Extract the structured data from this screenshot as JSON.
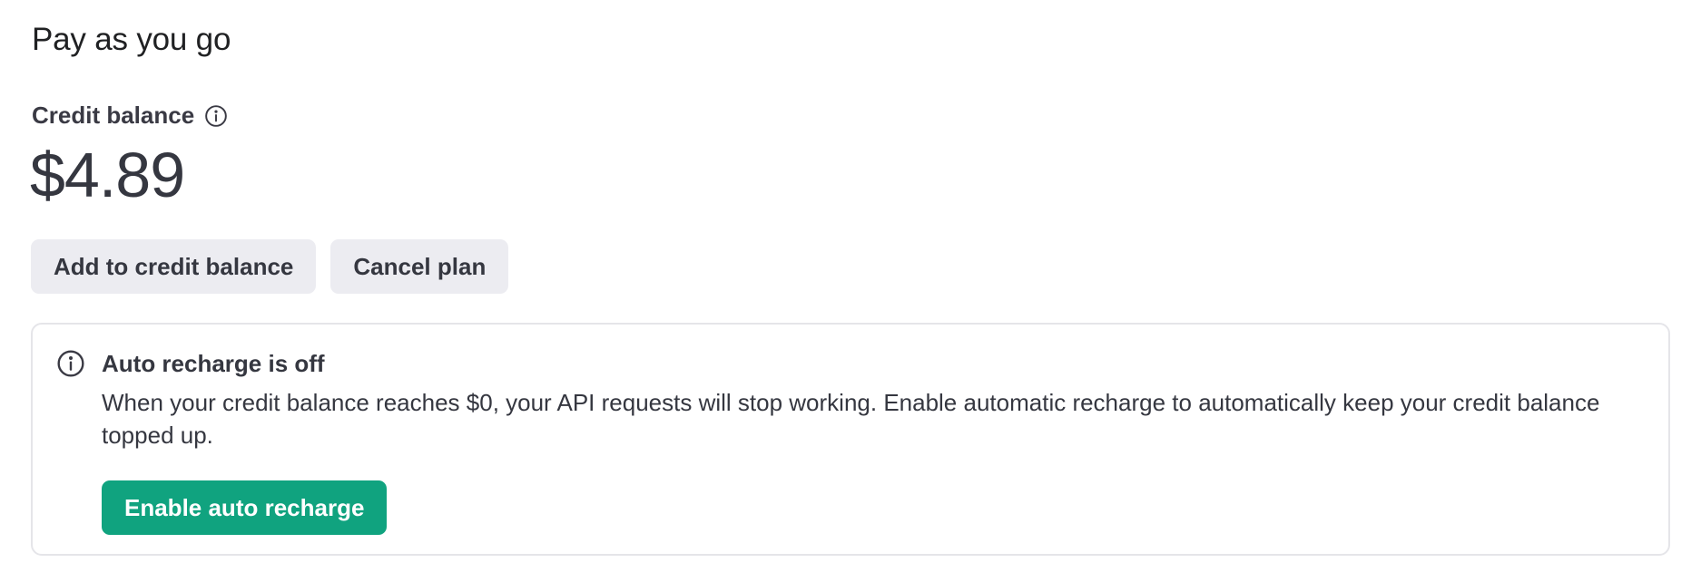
{
  "header": {
    "title": "Pay as you go"
  },
  "credit": {
    "label": "Credit balance",
    "info_icon": "info-icon",
    "balance": "$4.89"
  },
  "actions": {
    "add_label": "Add to credit balance",
    "cancel_label": "Cancel plan"
  },
  "notice": {
    "icon": "info-icon",
    "title": "Auto recharge is off",
    "body": "When your credit balance reaches $0, your API requests will stop working. Enable automatic recharge to automatically keep your credit balance topped up.",
    "button_label": "Enable auto recharge"
  },
  "colors": {
    "primary": "#10a37f",
    "secondary_button_bg": "#ececf1",
    "text": "#353740",
    "border": "#e5e5e9"
  }
}
